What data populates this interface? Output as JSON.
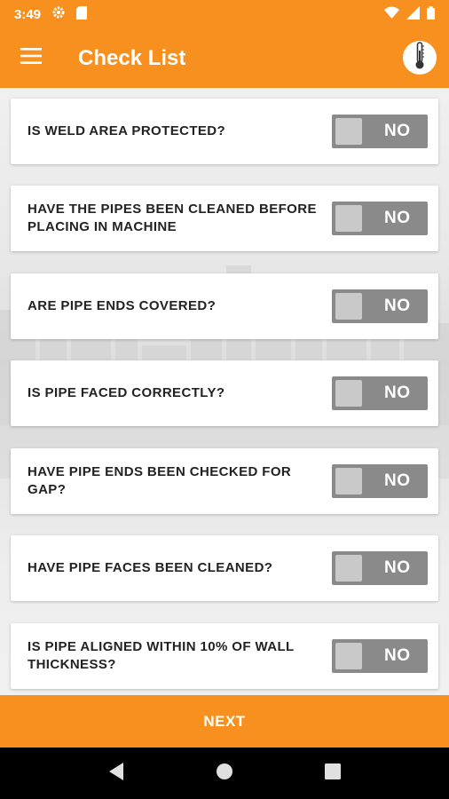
{
  "status_bar": {
    "time": "3:49",
    "icons": [
      "settings-gear-icon",
      "sd-card-icon",
      "wifi-icon",
      "cellular-signal-icon",
      "battery-icon"
    ]
  },
  "app_bar": {
    "title": "Check List",
    "menu_icon": "hamburger-menu-icon",
    "action_icon": "thermometer-icon"
  },
  "checklist": {
    "items": [
      {
        "question": "IS WELD AREA PROTECTED?",
        "toggle_label": "NO"
      },
      {
        "question": "HAVE THE PIPES BEEN CLEANED BEFORE PLACING IN MACHINE",
        "toggle_label": "NO"
      },
      {
        "question": "ARE PIPE ENDS COVERED?",
        "toggle_label": "NO"
      },
      {
        "question": "IS PIPE FACED CORRECTLY?",
        "toggle_label": "NO"
      },
      {
        "question": "HAVE PIPE ENDS BEEN CHECKED FOR GAP?",
        "toggle_label": "NO"
      },
      {
        "question": "HAVE PIPE FACES BEEN CLEANED?",
        "toggle_label": "NO"
      },
      {
        "question": "IS PIPE ALIGNED WITHIN 10% OF WALL THICKNESS?",
        "toggle_label": "NO"
      }
    ]
  },
  "footer": {
    "next_label": "NEXT"
  },
  "nav_bar": {
    "icons": [
      "back-icon",
      "home-icon",
      "recents-icon"
    ]
  },
  "colors": {
    "accent": "#f7901e",
    "toggle_off": "#8a8a8a",
    "nav": "#000000"
  }
}
